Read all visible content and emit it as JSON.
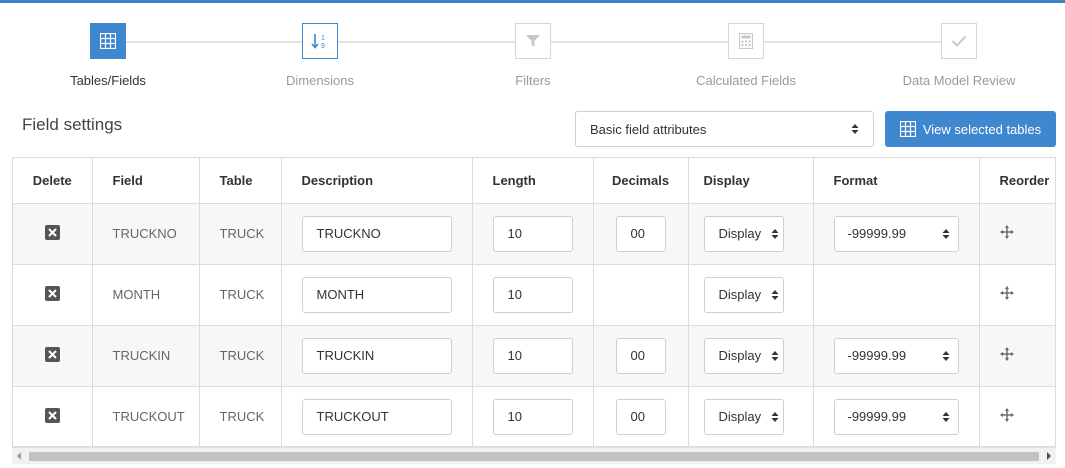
{
  "wizard": {
    "steps": [
      {
        "label": "Tables/Fields",
        "icon": "grid-icon",
        "state": "active"
      },
      {
        "label": "Dimensions",
        "icon": "sort-numeric-icon",
        "state": "current"
      },
      {
        "label": "Filters",
        "icon": "filter-icon",
        "state": "inactive"
      },
      {
        "label": "Calculated Fields",
        "icon": "calculator-icon",
        "state": "inactive"
      },
      {
        "label": "Data Model Review",
        "icon": "check-icon",
        "state": "inactive"
      }
    ]
  },
  "field_settings": {
    "title": "Field settings",
    "attribute_select": "Basic field attributes",
    "view_button": "View selected tables"
  },
  "table": {
    "headers": [
      "Delete",
      "Field",
      "Table",
      "Description",
      "Length",
      "Decimals",
      "Display",
      "Format",
      "Reorder"
    ],
    "rows": [
      {
        "field": "TRUCKNO",
        "table": "TRUCK",
        "description": "TRUCKNO",
        "length": "10",
        "decimals": "00",
        "display": "Display",
        "format": "-99999.99"
      },
      {
        "field": "MONTH",
        "table": "TRUCK",
        "description": "MONTH",
        "length": "10",
        "decimals": "",
        "display": "Display",
        "format": ""
      },
      {
        "field": "TRUCKIN",
        "table": "TRUCK",
        "description": "TRUCKIN",
        "length": "10",
        "decimals": "00",
        "display": "Display",
        "format": "-99999.99"
      },
      {
        "field": "TRUCKOUT",
        "table": "TRUCK",
        "description": "TRUCKOUT",
        "length": "10",
        "decimals": "00",
        "display": "Display",
        "format": "-99999.99"
      }
    ]
  },
  "colors": {
    "accent": "#3f87cf",
    "border": "#dcdcdc",
    "stripe": "#f7f7f7"
  }
}
